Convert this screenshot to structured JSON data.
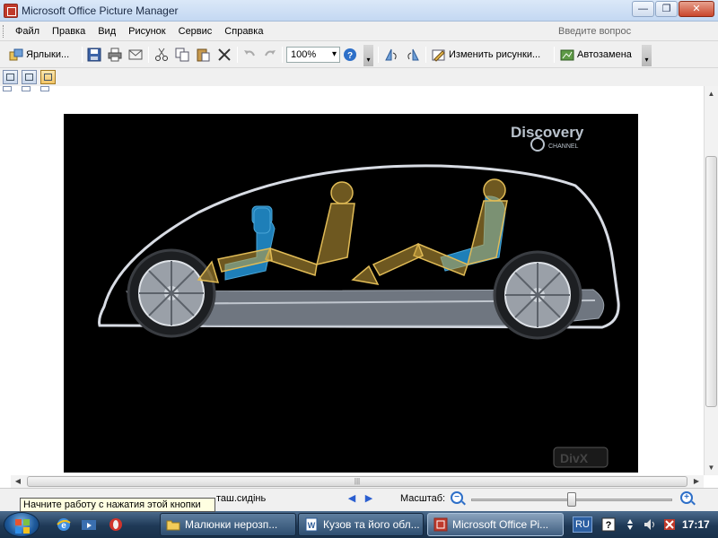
{
  "window": {
    "title": "Microsoft Office Picture Manager",
    "controls": {
      "minimize": "—",
      "maximize": "❐",
      "close": "✕"
    }
  },
  "menu": {
    "items": [
      "Файл",
      "Правка",
      "Вид",
      "Рисунок",
      "Сервис",
      "Справка"
    ],
    "ask_placeholder": "Введите вопрос"
  },
  "toolbar": {
    "shortcuts_label": "Ярлыки...",
    "zoom_value": "100%",
    "edit_pictures_label": "Изменить рисунки...",
    "autocorrect_label": "Автозамена"
  },
  "viewer": {
    "picture_subject": "car-interior-seats",
    "watermark": "Discovery CHANNEL",
    "corner_logo": "DivX"
  },
  "status": {
    "tooltip": "Начните работу с нажатия этой кнопки",
    "filename_fragment": "таш.сидінь",
    "zoom_label": "Масштаб:",
    "zoom_level": 0.5
  },
  "taskbar": {
    "tasks": [
      {
        "label": "Малюнки нерозп...",
        "icon": "folder-icon"
      },
      {
        "label": "Кузов та його обл...",
        "icon": "word-icon"
      },
      {
        "label": "Microsoft Office Pi...",
        "icon": "picture-manager-icon",
        "active": true
      }
    ],
    "language": "RU",
    "clock": "17:17"
  },
  "colors": {
    "accent": "#2d6fc8",
    "seat_blue": "#1e7fb8",
    "mannequin": "#c9a13a"
  }
}
